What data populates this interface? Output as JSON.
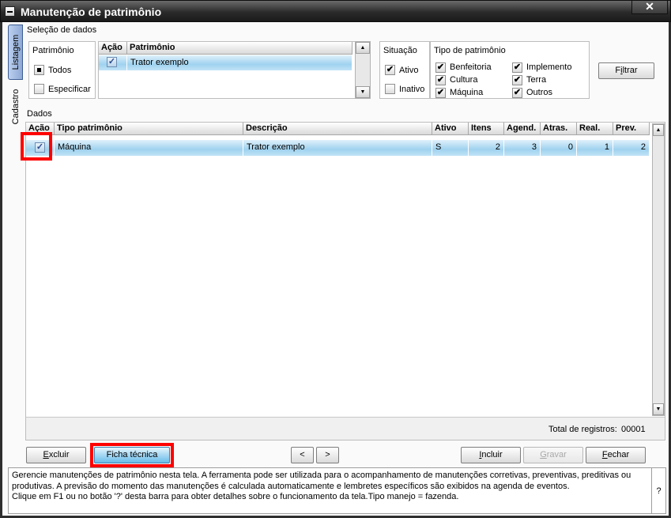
{
  "window": {
    "title": "Manutenção de patrimônio",
    "close_glyph": "✕"
  },
  "side_tabs": {
    "listagem": "Listagem",
    "cadastro": "Cadastro"
  },
  "selecao": {
    "title": "Seleção de dados",
    "patrimonio_group": {
      "caption": "Patrimônio",
      "options": [
        {
          "label": "Todos",
          "selected": true
        },
        {
          "label": "Especificar",
          "selected": false
        }
      ]
    },
    "patrimonio_list": {
      "headers": {
        "acao": "Ação",
        "patrimonio": "Patrimônio"
      },
      "rows": [
        {
          "checked": true,
          "name": "Trator exemplo"
        }
      ],
      "scroll_up": "▲",
      "scroll_down": "▼"
    },
    "situacao": {
      "caption": "Situação",
      "options": [
        {
          "label": "Ativo",
          "checked": true
        },
        {
          "label": "Inativo",
          "checked": false
        }
      ]
    },
    "tipo_patrimonio": {
      "caption": "Tipo de patrimônio",
      "options": [
        {
          "label": "Benfeitoria",
          "checked": true
        },
        {
          "label": "Implemento",
          "checked": true
        },
        {
          "label": "Cultura",
          "checked": true
        },
        {
          "label": "Terra",
          "checked": true
        },
        {
          "label": "Máquina",
          "checked": true
        },
        {
          "label": "Outros",
          "checked": true
        }
      ]
    },
    "filtrar_button": {
      "prefix": "F",
      "underlined": "i",
      "suffix": "ltrar"
    }
  },
  "dados": {
    "title": "Dados",
    "columns": {
      "acao": "Ação",
      "tipo": "Tipo patrimônio",
      "descricao": "Descrição",
      "ativo": "Ativo",
      "itens": "Itens",
      "agend": "Agend.",
      "atras": "Atras.",
      "real": "Real.",
      "prev": "Prev."
    },
    "rows": [
      {
        "checked": true,
        "tipo": "Máquina",
        "descricao": "Trator exemplo",
        "ativo": "S",
        "itens": "2",
        "agend": "3",
        "atras": "0",
        "real": "1",
        "prev": "2"
      }
    ],
    "total_label": "Total de registros:",
    "total_value": "00001",
    "scroll_up": "▲",
    "scroll_down": "▼"
  },
  "buttons": {
    "excluir": {
      "underlined": "E",
      "rest": "xcluir"
    },
    "ficha": "Ficha técnica",
    "prev": "<",
    "next": ">",
    "incluir": {
      "underlined": "I",
      "rest": "ncluir"
    },
    "gravar": {
      "underlined": "G",
      "rest": "ravar"
    },
    "fechar": {
      "underlined": "F",
      "rest": "echar"
    }
  },
  "status": {
    "lines": [
      "Gerencie manutenções de patrimônio nesta tela. A ferramenta pode ser utilizada para o acompanhamento de manutenções corretivas, preventivas, preditivas ou",
      "produtivas. A previsão do momento das manutenções é calculada automaticamente e lembretes específicos são exibidos na agenda de eventos.",
      "Clique em F1 ou no botão '?' desta barra para obter detalhes sobre o funcionamento da tela.Tipo manejo = fazenda."
    ],
    "help": "?"
  },
  "check_glyph": "✔",
  "check_glyph_blue": "✓",
  "colors": {
    "selection_blue": "#9fd2ef",
    "highlight_red": "#ff0000",
    "titlebar": "#2b2b2b"
  }
}
